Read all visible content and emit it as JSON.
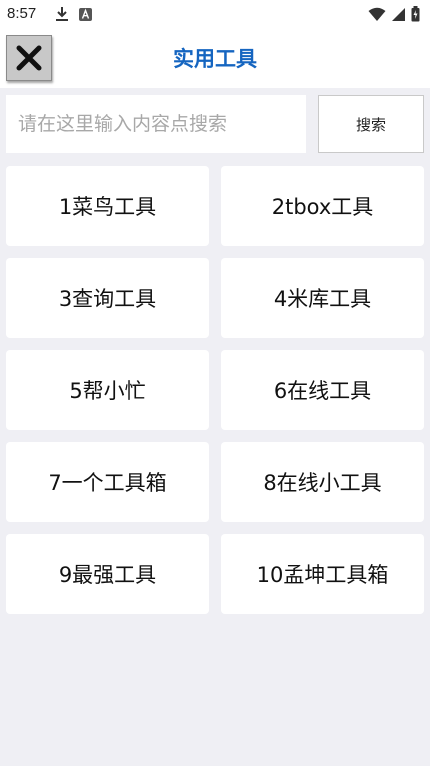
{
  "status_bar": {
    "time": "8:57",
    "icons": [
      "download-icon",
      "a-notification-icon",
      "wifi-icon",
      "signal-icon",
      "battery-charging-icon"
    ]
  },
  "header": {
    "title": "实用工具",
    "close_icon": "close-x-icon"
  },
  "search": {
    "placeholder": "请在这里输入内容点搜索",
    "value": "",
    "button_label": "搜索"
  },
  "tools": [
    {
      "label": "1菜鸟工具"
    },
    {
      "label": "2tbox工具"
    },
    {
      "label": "3查询工具"
    },
    {
      "label": "4米库工具"
    },
    {
      "label": "5帮小忙"
    },
    {
      "label": "6在线工具"
    },
    {
      "label": "7一个工具箱"
    },
    {
      "label": "8在线小工具"
    },
    {
      "label": "9最强工具"
    },
    {
      "label": "10孟坤工具箱"
    }
  ],
  "colors": {
    "title": "#1565c0",
    "background": "#efeff4",
    "card": "#ffffff"
  }
}
